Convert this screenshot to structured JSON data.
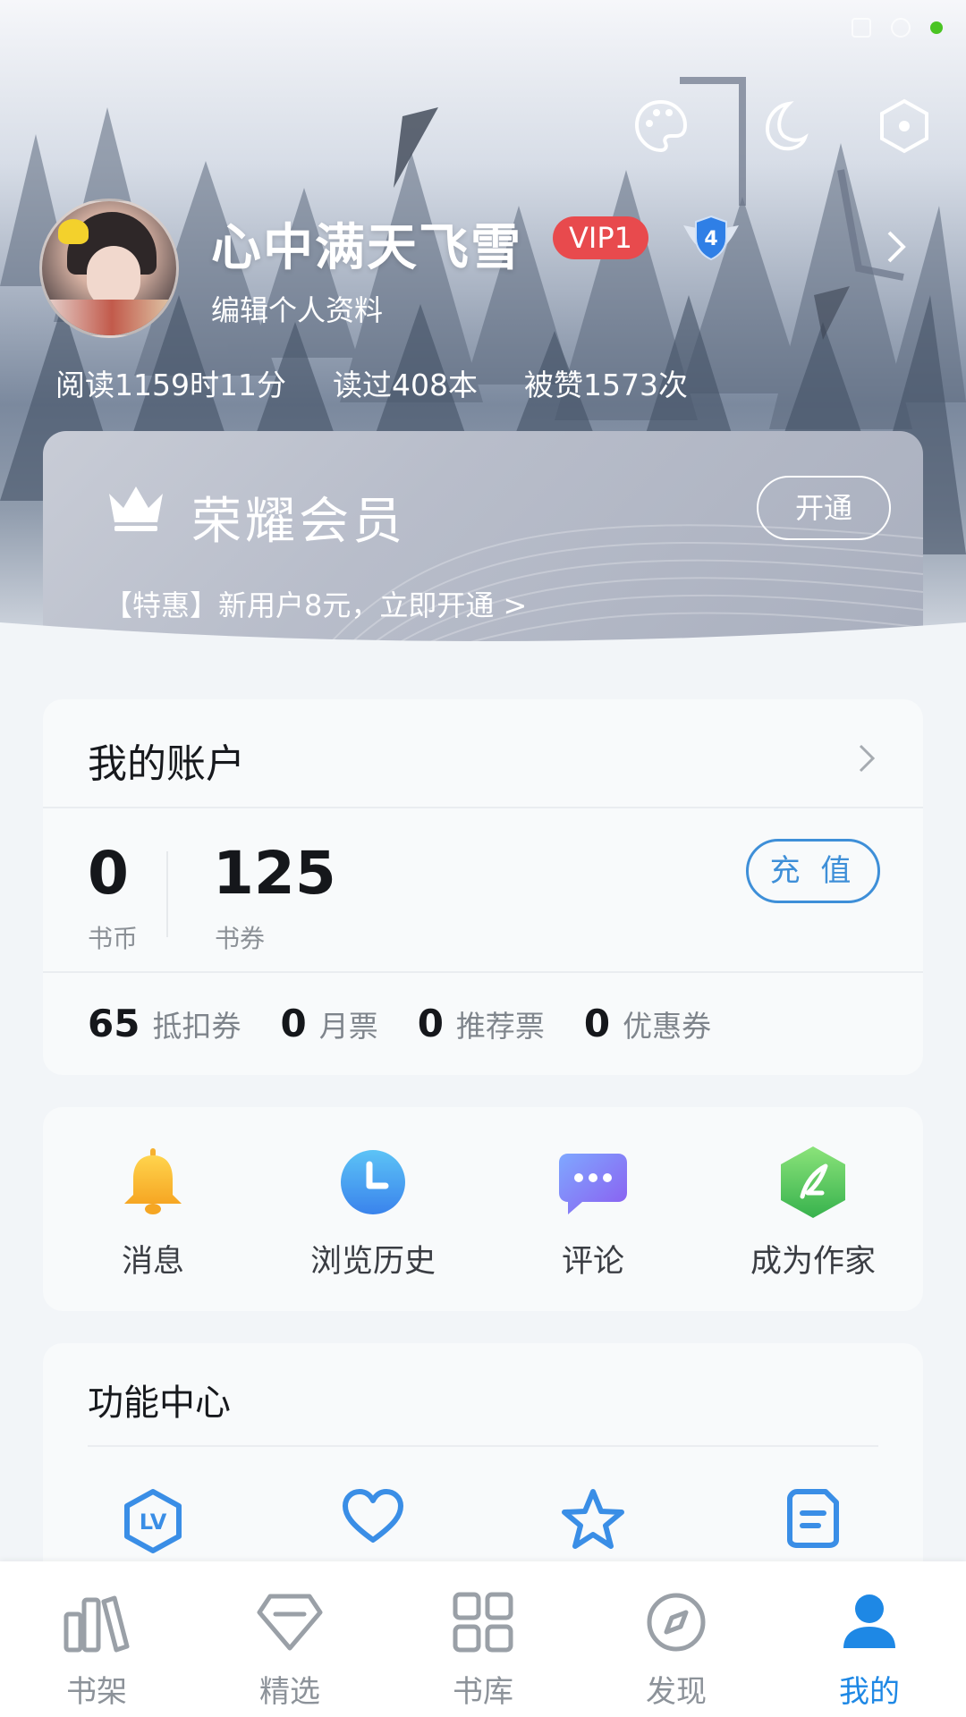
{
  "profile": {
    "username": "心中满天飞雪",
    "vip_badge": "VIP1",
    "level": "4",
    "edit_label": "编辑个人资料"
  },
  "stats": {
    "read_time": "阅读1159时11分",
    "books_read": "读过408本",
    "likes": "被赞1573次"
  },
  "vip_card": {
    "title": "荣耀会员",
    "open_label": "开通",
    "promo": "【特惠】新用户8元，立即开通 >"
  },
  "account": {
    "title": "我的账户",
    "coins_value": "0",
    "coins_label": "书币",
    "vouchers_value": "125",
    "vouchers_label": "书券",
    "recharge_label": "充 值",
    "tickets": [
      {
        "value": "65",
        "label": "抵扣券"
      },
      {
        "value": "0",
        "label": "月票"
      },
      {
        "value": "0",
        "label": "推荐票"
      },
      {
        "value": "0",
        "label": "优惠券"
      }
    ]
  },
  "quick_actions": [
    {
      "label": "消息",
      "icon": "bell-icon"
    },
    {
      "label": "浏览历史",
      "icon": "clock-icon"
    },
    {
      "label": "评论",
      "icon": "chat-icon"
    },
    {
      "label": "成为作家",
      "icon": "quill-icon"
    }
  ],
  "function_center": {
    "title": "功能中心",
    "icons": [
      "lv-level-icon",
      "heart-icon",
      "star-icon",
      "note-icon"
    ]
  },
  "tabbar": [
    {
      "label": "书架",
      "icon": "bookshelf-icon",
      "active": false
    },
    {
      "label": "精选",
      "icon": "diamond-icon",
      "active": false
    },
    {
      "label": "书库",
      "icon": "grid-icon",
      "active": false
    },
    {
      "label": "发现",
      "icon": "compass-icon",
      "active": false
    },
    {
      "label": "我的",
      "icon": "person-icon",
      "active": true
    }
  ],
  "colors": {
    "accent": "#1e88e5",
    "vip_red": "#e84a4d",
    "recharge_blue": "#3e8fd8"
  }
}
